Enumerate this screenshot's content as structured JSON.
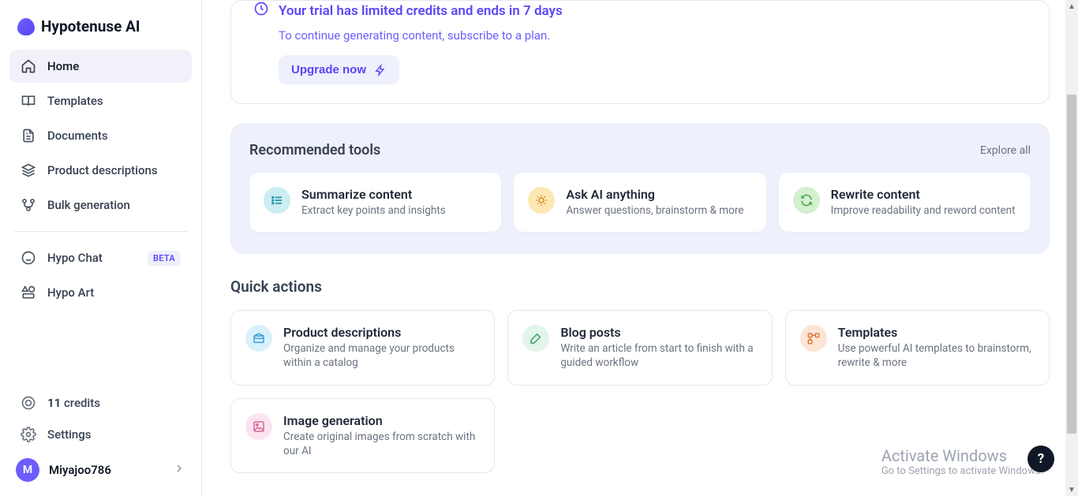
{
  "brand": "Hypotenuse AI",
  "sidebar": {
    "items": [
      {
        "label": "Home"
      },
      {
        "label": "Templates"
      },
      {
        "label": "Documents"
      },
      {
        "label": "Product descriptions"
      },
      {
        "label": "Bulk generation"
      }
    ],
    "secondary": [
      {
        "label": "Hypo Chat",
        "badge": "BETA"
      },
      {
        "label": "Hypo Art"
      }
    ],
    "credits_num": "11",
    "credits_label": "credits",
    "settings_label": "Settings",
    "user": {
      "initial": "M",
      "name": "Miyajoo786"
    }
  },
  "trial": {
    "title": "Your trial has limited credits and ends in 7 days",
    "subtitle": "To continue generating content, subscribe to a plan.",
    "upgrade_label": "Upgrade now"
  },
  "recommended": {
    "title": "Recommended tools",
    "explore_label": "Explore all",
    "tools": [
      {
        "title": "Summarize content",
        "desc": "Extract key points and insights"
      },
      {
        "title": "Ask AI anything",
        "desc": "Answer questions, brainstorm & more"
      },
      {
        "title": "Rewrite content",
        "desc": "Improve readability and reword content"
      }
    ]
  },
  "quick": {
    "title": "Quick actions",
    "actions": [
      {
        "title": "Product descriptions",
        "desc": "Organize and manage your products within a catalog"
      },
      {
        "title": "Blog posts",
        "desc": "Write an article from start to finish with a guided workflow"
      },
      {
        "title": "Templates",
        "desc": "Use powerful AI templates to brainstorm, rewrite & more"
      },
      {
        "title": "Image generation",
        "desc": "Create original images from scratch with our AI"
      }
    ]
  },
  "overlay": {
    "activate_title": "Activate Windows",
    "activate_sub": "Go to Settings to activate Windows.",
    "help": "?"
  }
}
